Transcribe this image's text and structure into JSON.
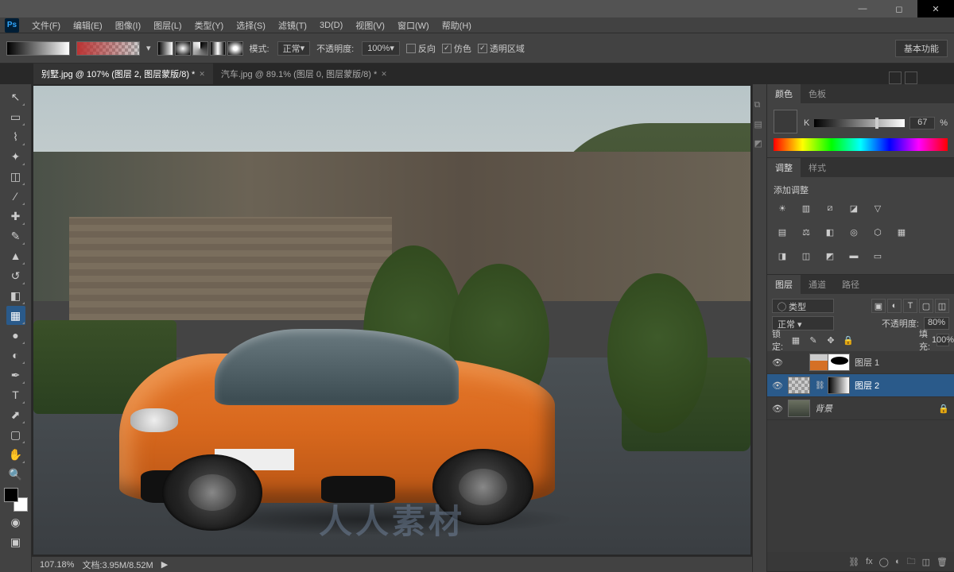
{
  "titlebar": {
    "minimize": "—",
    "maximize": "◻",
    "close": "✕"
  },
  "menu": {
    "file": "文件(F)",
    "edit": "编辑(E)",
    "image": "图像(I)",
    "layer": "图层(L)",
    "type": "类型(Y)",
    "select": "选择(S)",
    "filter": "滤镜(T)",
    "threeD": "3D(D)",
    "view": "视图(V)",
    "window": "窗口(W)",
    "help": "帮助(H)"
  },
  "options": {
    "modeLabel": "模式:",
    "modeValue": "正常",
    "opacityLabel": "不透明度:",
    "opacityValue": "100%",
    "reverse": "反向",
    "dither": "仿色",
    "transparency": "透明区域",
    "workspace": "基本功能"
  },
  "tabs": {
    "tab1": "别墅.jpg @ 107% (图层 2, 图层蒙版/8) *",
    "tab2": "汽车.jpg @ 89.1% (图层 0, 图层蒙版/8) *"
  },
  "canvas": {
    "watermark": "人人素材"
  },
  "status": {
    "zoom": "107.18%",
    "docsize": "文档:3.95M/8.52M"
  },
  "panels": {
    "color": {
      "tab1": "颜色",
      "tab2": "色板",
      "kLabel": "K",
      "kValue": "67",
      "pct": "%"
    },
    "adjust": {
      "tab1": "调整",
      "tab2": "样式",
      "title": "添加调整"
    },
    "layers": {
      "tab1": "图层",
      "tab2": "通道",
      "tab3": "路径",
      "filterLabel": "◯ 类型",
      "blendMode": "正常",
      "opacityLabel": "不透明度:",
      "opacityValue": "80%",
      "lockLabel": "锁定:",
      "fillLabel": "填充:",
      "fillValue": "100%",
      "layer1": "图层 1",
      "layer2": "图层 2",
      "bg": "背景"
    }
  }
}
